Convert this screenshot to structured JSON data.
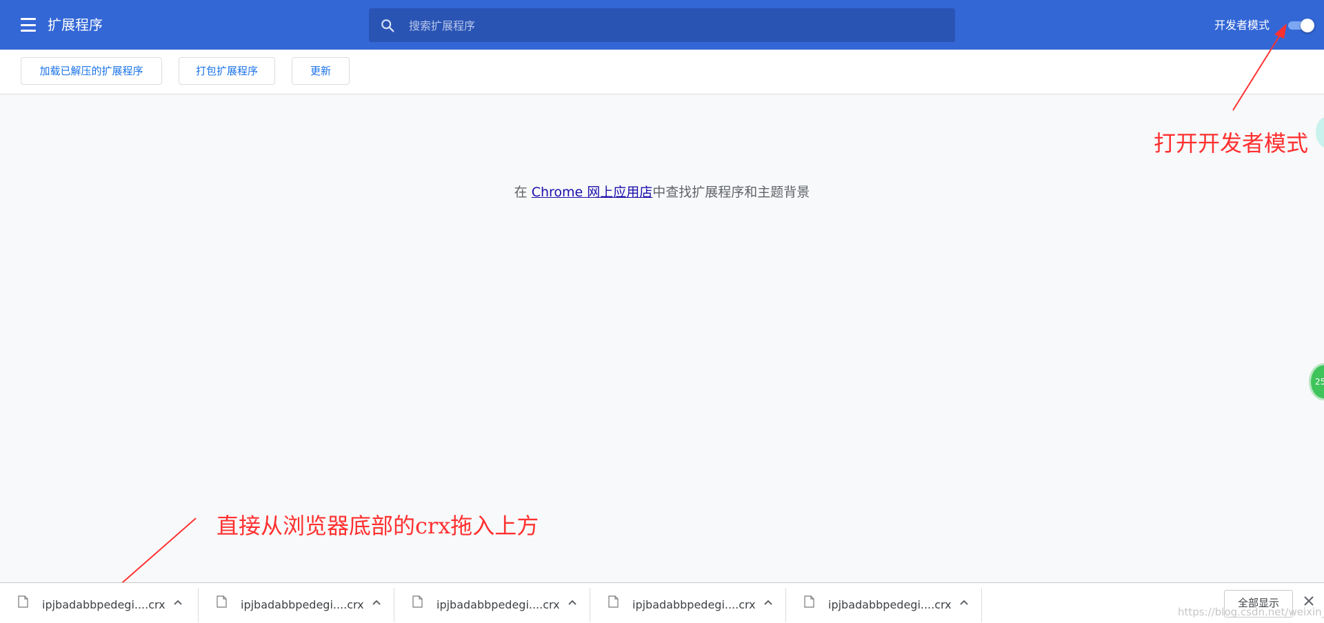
{
  "header": {
    "title": "扩展程序",
    "menu_icon": "hamburger-menu-icon",
    "search_placeholder": "搜索扩展程序",
    "search_icon": "search-icon",
    "dev_mode_label": "开发者模式",
    "dev_mode_on": true,
    "bg_color": "#3367d6"
  },
  "toolbar": {
    "load_unpacked": "加载已解压的扩展程序",
    "pack_extension": "打包扩展程序",
    "update": "更新"
  },
  "main": {
    "empty_prefix": "在 ",
    "store_link": "Chrome 网上应用店",
    "empty_suffix": "中查找扩展程序和主题背景"
  },
  "annotations": {
    "dev_mode_note": "打开开发者模式",
    "drag_note": "直接从浏览器底部的crx拖入上方",
    "color": "#ff3030"
  },
  "widgets": {
    "badge_text": "25"
  },
  "downloads": {
    "items": [
      {
        "name": "ipjbadabbpedegi....crx"
      },
      {
        "name": "ipjbadabbpedegi....crx"
      },
      {
        "name": "ipjbadabbpedegi....crx"
      },
      {
        "name": "ipjbadabbpedegi....crx"
      },
      {
        "name": "ipjbadabbpedegi....crx"
      }
    ],
    "show_all": "全部显示",
    "close_icon": "close-icon"
  },
  "watermark": "https://blog.csdn.net/weixin_..."
}
